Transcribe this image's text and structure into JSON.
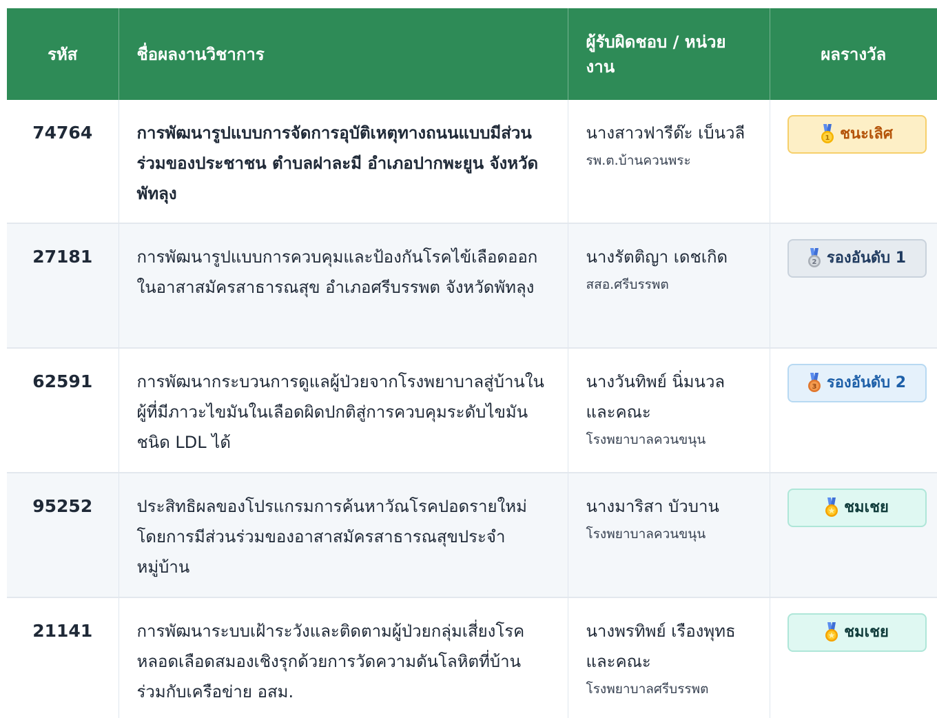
{
  "table": {
    "headers": {
      "code": "รหัส",
      "title": "ชื่อผลงานวิชาการ",
      "owner": "ผู้รับผิดชอบ / หน่วยงาน",
      "award": "ผลรางวัล"
    },
    "rows": [
      {
        "code": "74764",
        "title": "การพัฒนารูปแบบการจัดการอุบัติเหตุทางถนนแบบมีส่วนร่วมของประชาชน ตำบลฝาละมี อำเภอปากพะยูน จังหวัดพัทลุง",
        "owner_name": "นางสาวฟารีด๊ะ เบ็นวลี",
        "owner_unit": "รพ.ต.บ้านควนพระ",
        "award": "ชนะเลิศ",
        "award_icon": "gold-medal-icon",
        "award_color": "#b45309"
      },
      {
        "code": "27181",
        "title": "การพัฒนารูปแบบการควบคุมและป้องกันโรคไข้เลือดออกในอาสาสมัครสาธารณสุข อำเภอศรีบรรพต จังหวัดพัทลุง",
        "owner_name": "นางรัตติญา เดชเกิด",
        "owner_unit": "สสอ.ศรีบรรพต",
        "award": "รองอันดับ 1",
        "award_icon": "silver-medal-icon",
        "award_color": "#1f3a5f"
      },
      {
        "code": "62591",
        "title": "การพัฒนากระบวนการดูแลผู้ป่วยจากโรงพยาบาลสู่บ้านในผู้ที่มีภาวะไขมันในเลือดผิดปกติสู่การควบคุมระดับไขมันชนิด LDL ได้",
        "owner_name": "นางวันทิพย์ นิ่มนวล และคณะ",
        "owner_unit": "โรงพยาบาลควนขนุน",
        "award": "รองอันดับ 2",
        "award_icon": "bronze-medal-icon",
        "award_color": "#1d5fa8"
      },
      {
        "code": "95252",
        "title": "ประสิทธิผลของโปรแกรมการค้นหาวัณโรคปอดรายใหม่โดยการมีส่วนร่วมของอาสาสมัครสาธารณสุขประจำหมู่บ้าน",
        "owner_name": "นางมาริสา บัวบาน",
        "owner_unit": "โรงพยาบาลควนขนุน",
        "award": "ชมเชย",
        "award_icon": "honor-medal-icon",
        "award_color": "#0f3b3a"
      },
      {
        "code": "21141",
        "title": "การพัฒนาระบบเฝ้าระวังและติดตามผู้ป่วยกลุ่มเสี่ยงโรคหลอดเลือดสมองเชิงรุกด้วยการวัดความดันโลหิตที่บ้านร่วมกับเครือข่าย อสม.",
        "owner_name": "นางพรทิพย์ เรืองพุทธ และคณะ",
        "owner_unit": "โรงพยาบาลศรีบรรพต",
        "award": "ชมเชย",
        "award_icon": "honor-medal-icon",
        "award_color": "#0f3b3a"
      }
    ]
  },
  "colors": {
    "header_bg": "#2e8b57",
    "header_text": "#ffffff",
    "row_alt_bg": "#f4f7fa"
  }
}
